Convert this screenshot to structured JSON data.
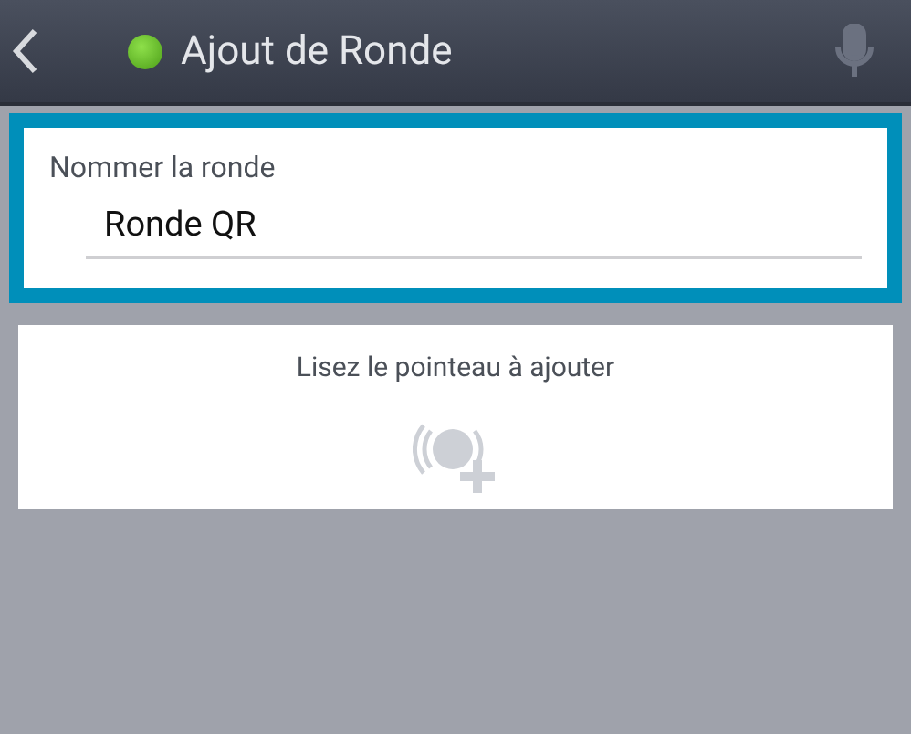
{
  "header": {
    "title": "Ajout de Ronde"
  },
  "name_field": {
    "label": "Nommer la ronde",
    "value": "Ronde QR",
    "focused": true
  },
  "scan_card": {
    "text": "Lisez le pointeau à ajouter"
  }
}
